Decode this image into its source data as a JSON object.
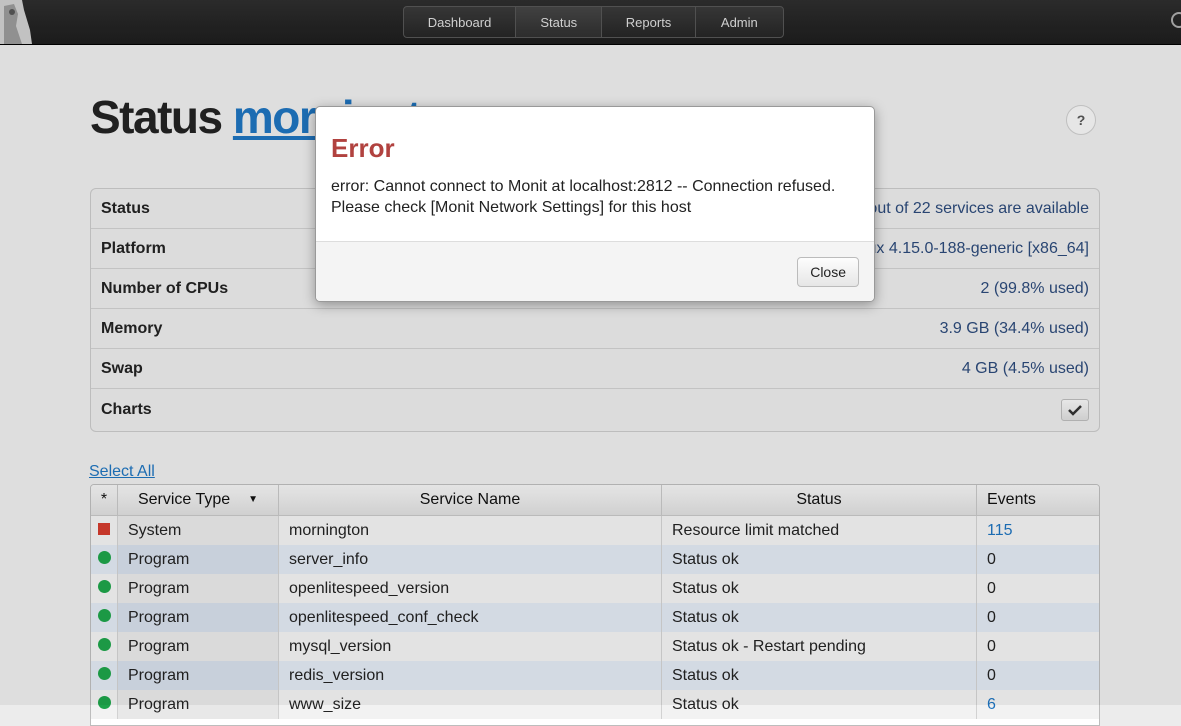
{
  "nav": {
    "items": [
      {
        "label": "Dashboard"
      },
      {
        "label": "Status"
      },
      {
        "label": "Reports"
      },
      {
        "label": "Admin"
      }
    ]
  },
  "page": {
    "title": "Status",
    "host": "mornington",
    "help_label": "?"
  },
  "info": {
    "rows": [
      {
        "label": "Status",
        "value": "22 out of 22 services are available"
      },
      {
        "label": "Platform",
        "value": "Linux 4.15.0-188-generic [x86_64]"
      },
      {
        "label": "Number of CPUs",
        "value": "2 (99.8% used)"
      },
      {
        "label": "Memory",
        "value": "3.9 GB (34.4% used)"
      },
      {
        "label": "Swap",
        "value": "4 GB (4.5% used)"
      },
      {
        "label": "Charts",
        "value": ""
      }
    ]
  },
  "select_all": "Select All",
  "services": {
    "headers": {
      "star": "*",
      "type": "Service Type",
      "name": "Service Name",
      "status": "Status",
      "events": "Events"
    },
    "rows": [
      {
        "indicator": "square-red",
        "type": "System",
        "name": "mornington",
        "status": "Resource limit matched",
        "events": "115",
        "events_link": true
      },
      {
        "indicator": "dot-green",
        "type": "Program",
        "name": "server_info",
        "status": "Status ok",
        "events": "0",
        "events_link": false
      },
      {
        "indicator": "dot-green",
        "type": "Program",
        "name": "openlitespeed_version",
        "status": "Status ok",
        "events": "0",
        "events_link": false
      },
      {
        "indicator": "dot-green",
        "type": "Program",
        "name": "openlitespeed_conf_check",
        "status": "Status ok",
        "events": "0",
        "events_link": false
      },
      {
        "indicator": "dot-green",
        "type": "Program",
        "name": "mysql_version",
        "status": "Status ok - Restart pending",
        "events": "0",
        "events_link": false
      },
      {
        "indicator": "dot-green",
        "type": "Program",
        "name": "redis_version",
        "status": "Status ok",
        "events": "0",
        "events_link": false
      },
      {
        "indicator": "dot-green",
        "type": "Program",
        "name": "www_size",
        "status": "Status ok",
        "events": "6",
        "events_link": true
      }
    ]
  },
  "colors": {
    "red": "#d23b2d",
    "green": "#1ea34a",
    "link": "#1e73be",
    "error_title": "#b1423f"
  },
  "modal": {
    "title": "Error",
    "message_line1": "error: Cannot connect to Monit at localhost:2812 -- Connection refused.",
    "message_line2": "Please check [Monit Network Settings] for this host",
    "close_label": "Close"
  }
}
